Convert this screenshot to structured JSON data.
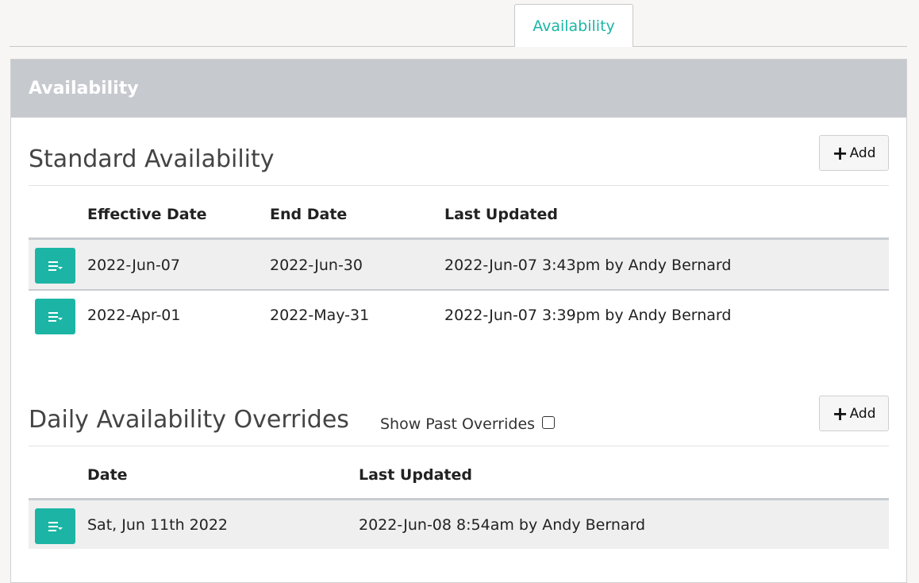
{
  "tabs": [
    {
      "label": "Availability",
      "active": true
    }
  ],
  "panel": {
    "title": "Availability"
  },
  "standard": {
    "title": "Standard Availability",
    "add_label": "Add",
    "headers": {
      "effective": "Effective Date",
      "end": "End Date",
      "updated": "Last Updated"
    },
    "rows": [
      {
        "effective": "2022-Jun-07",
        "end": "2022-Jun-30",
        "updated": "2022-Jun-07 3:43pm by Andy Bernard"
      },
      {
        "effective": "2022-Apr-01",
        "end": "2022-May-31",
        "updated": "2022-Jun-07 3:39pm by Andy Bernard"
      }
    ]
  },
  "overrides": {
    "title": "Daily Availability Overrides",
    "show_past_label": "Show Past Overrides",
    "show_past_checked": false,
    "add_label": "Add",
    "headers": {
      "date": "Date",
      "updated": "Last Updated"
    },
    "rows": [
      {
        "date": "Sat, Jun 11th 2022",
        "updated": "2022-Jun-08 8:54am by Andy Bernard"
      }
    ]
  },
  "colors": {
    "accent": "#1cb5a5",
    "header_bg": "#c6c9ce"
  },
  "icons": {
    "row_menu": "list-dropdown-icon",
    "add": "plus-icon"
  }
}
